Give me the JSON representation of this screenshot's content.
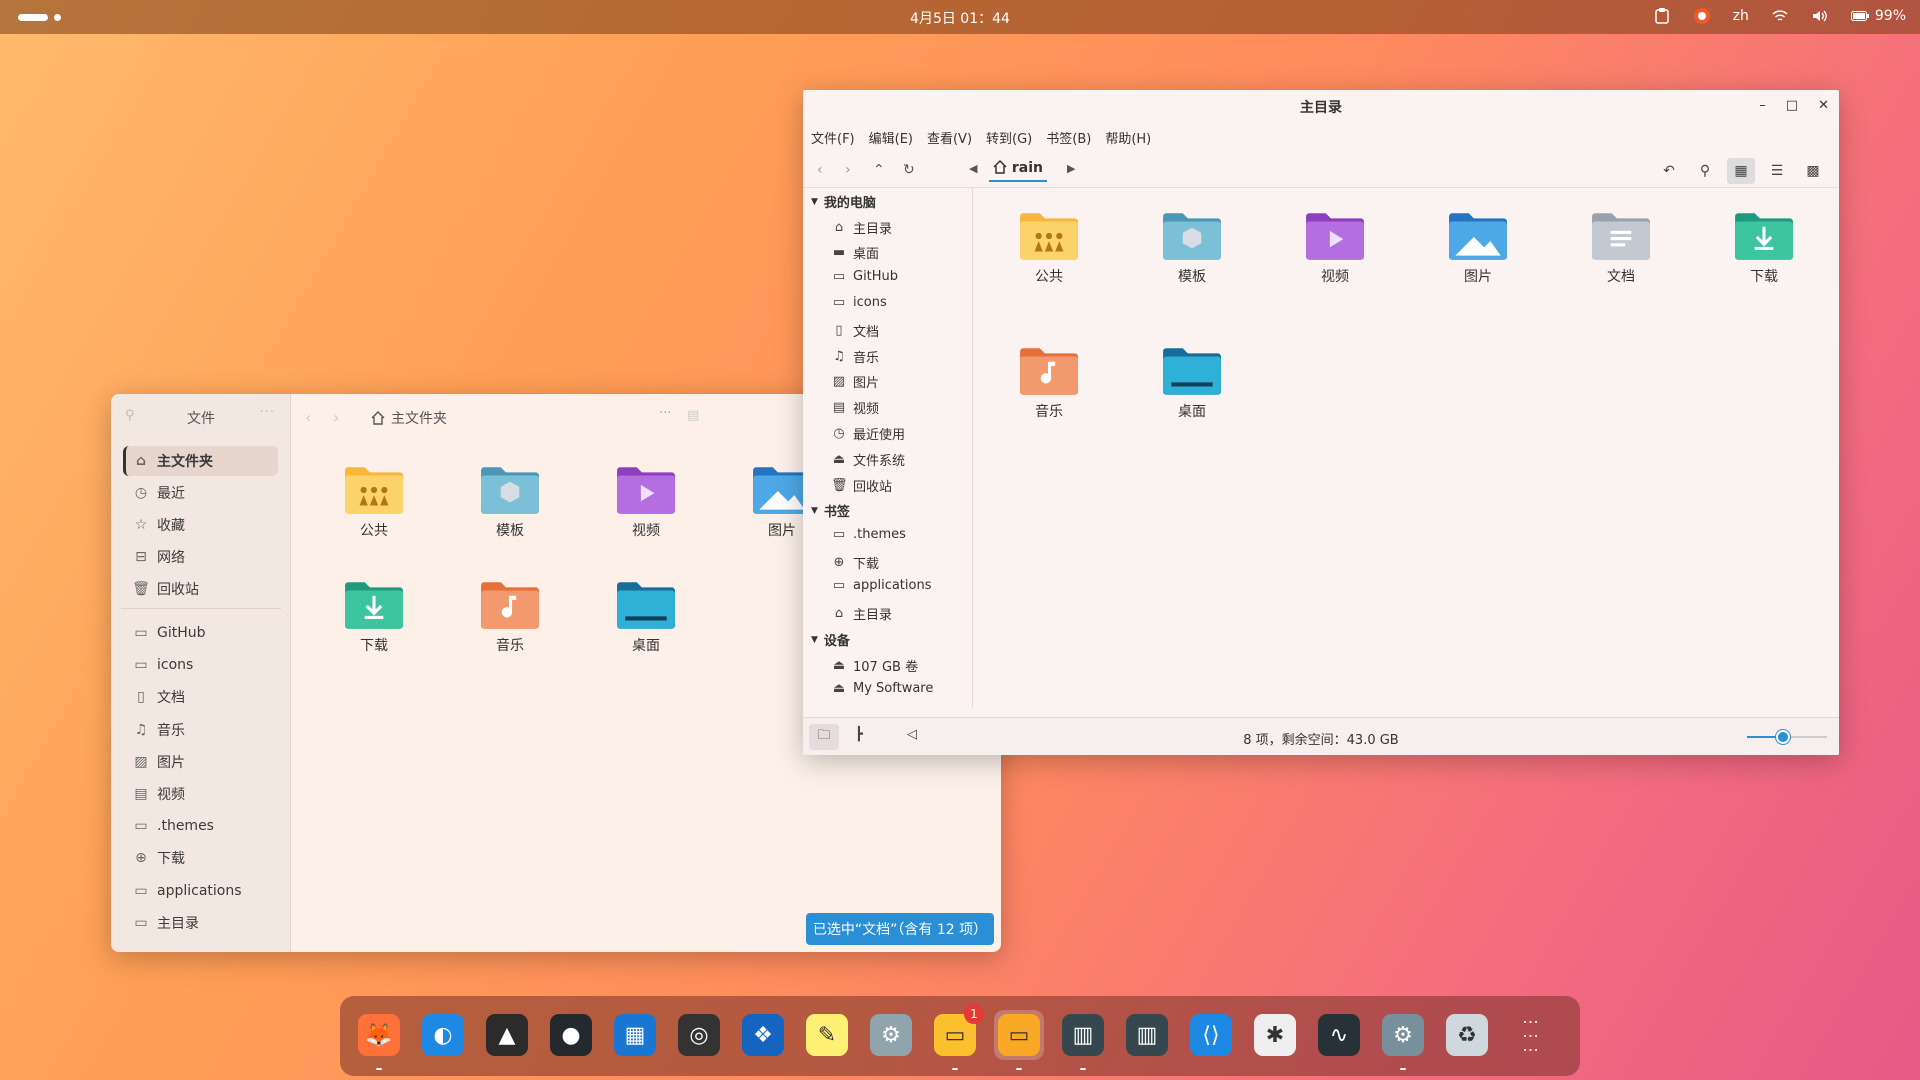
{
  "topbar": {
    "clock": "4月5日 01：44",
    "lang": "zh",
    "battery": "99%"
  },
  "left_window": {
    "sidebar_title": "文件",
    "nav": [
      {
        "label": "主文件夹",
        "icon": "home-icon"
      },
      {
        "label": "最近",
        "icon": "clock-icon"
      },
      {
        "label": "收藏",
        "icon": "star-icon"
      },
      {
        "label": "网络",
        "icon": "network-icon"
      },
      {
        "label": "回收站",
        "icon": "trash-icon"
      }
    ],
    "places": [
      {
        "label": "GitHub",
        "icon": "folder-icon"
      },
      {
        "label": "icons",
        "icon": "folder-icon"
      },
      {
        "label": "文档",
        "icon": "document-icon"
      },
      {
        "label": "音乐",
        "icon": "music-icon"
      },
      {
        "label": "图片",
        "icon": "image-icon"
      },
      {
        "label": "视频",
        "icon": "video-icon"
      },
      {
        "label": ".themes",
        "icon": "folder-icon"
      },
      {
        "label": "下载",
        "icon": "download-icon"
      },
      {
        "label": "applications",
        "icon": "folder-icon"
      },
      {
        "label": "主目录",
        "icon": "folder-icon"
      }
    ],
    "path": "主文件夹",
    "files": [
      {
        "label": "公共",
        "type": "public"
      },
      {
        "label": "模板",
        "type": "templates"
      },
      {
        "label": "视频",
        "type": "videos"
      },
      {
        "label": "图片",
        "type": "pictures"
      },
      {
        "label": "下载",
        "type": "downloads"
      },
      {
        "label": "音乐",
        "type": "music"
      },
      {
        "label": "桌面",
        "type": "desktop"
      }
    ],
    "toast": "已选中“文档”（含有 12 项）"
  },
  "right_window": {
    "title": "主目录",
    "menu": [
      "文件(F)",
      "编辑(E)",
      "查看(V)",
      "转到(G)",
      "书签(B)",
      "帮助(H)"
    ],
    "crumb": "rain",
    "tree": {
      "computer": {
        "label": "我的电脑",
        "items": [
          {
            "label": "主目录",
            "icon": "home-icon"
          },
          {
            "label": "桌面",
            "icon": "desktop-icon"
          },
          {
            "label": "GitHub",
            "icon": "folder-icon"
          },
          {
            "label": "icons",
            "icon": "folder-icon"
          },
          {
            "label": "文档",
            "icon": "document-icon"
          },
          {
            "label": "音乐",
            "icon": "music-icon"
          },
          {
            "label": "图片",
            "icon": "image-icon"
          },
          {
            "label": "视频",
            "icon": "video-icon"
          },
          {
            "label": "最近使用",
            "icon": "clock-icon"
          },
          {
            "label": "文件系统",
            "icon": "drive-icon"
          },
          {
            "label": "回收站",
            "icon": "trash-icon"
          }
        ]
      },
      "bookmarks": {
        "label": "书签",
        "items": [
          {
            "label": ".themes",
            "icon": "folder-icon"
          },
          {
            "label": "下载",
            "icon": "download-icon"
          },
          {
            "label": "applications",
            "icon": "folder-icon"
          },
          {
            "label": "主目录",
            "icon": "home-icon"
          }
        ]
      },
      "devices": {
        "label": "设备",
        "items": [
          {
            "label": "107 GB 卷",
            "icon": "drive-icon"
          },
          {
            "label": "My Software",
            "icon": "drive-icon"
          }
        ]
      }
    },
    "files": [
      {
        "label": "公共",
        "type": "public"
      },
      {
        "label": "模板",
        "type": "templates"
      },
      {
        "label": "视频",
        "type": "videos"
      },
      {
        "label": "图片",
        "type": "pictures"
      },
      {
        "label": "文档",
        "type": "documents"
      },
      {
        "label": "下载",
        "type": "downloads"
      },
      {
        "label": "音乐",
        "type": "music"
      },
      {
        "label": "桌面",
        "type": "desktop"
      }
    ],
    "status": "8 项，剩余空间：43.0 GB",
    "zoom_level": 0.45
  },
  "dock": {
    "apps": [
      "firefox",
      "edge",
      "inkscape",
      "github-desktop",
      "calendar",
      "music-player",
      "app-store",
      "notes",
      "settings",
      "files",
      "file-manager",
      "system-monitor-1",
      "system-monitor-2",
      "vscode",
      "color-picker",
      "terminal-monitor",
      "control-center",
      "trash",
      "app-grid"
    ],
    "badge": "1"
  },
  "colors": {
    "accent": "#2a8fd4"
  }
}
